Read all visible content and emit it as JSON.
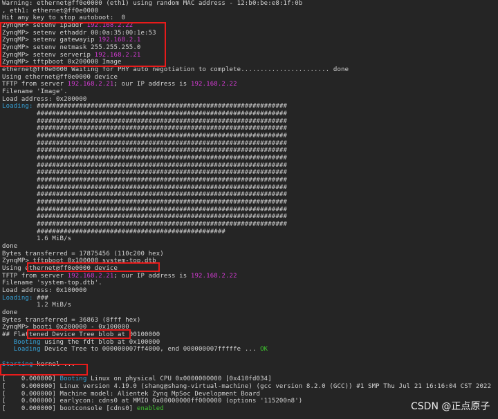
{
  "terminal": {
    "lines": [
      [
        {
          "t": "Warning: ethernet@ff0e0000 (eth1) using random MAC address - 12:b0:be:e8:1f:0b"
        }
      ],
      [
        {
          "t": ", eth1: ethernet@ff0e0000"
        }
      ],
      [
        {
          "t": "Hit any key to stop autoboot:  0"
        }
      ],
      [
        {
          "t": "ZynqMP> setenv ipaddr "
        },
        {
          "t": "192.168.2.22",
          "c": "pink"
        }
      ],
      [
        {
          "t": "ZynqMP> setenv ethaddr 00:0a:35:00:1e:53"
        }
      ],
      [
        {
          "t": "ZynqMP> setenv gatewayip "
        },
        {
          "t": "192.168.2.1",
          "c": "pink"
        }
      ],
      [
        {
          "t": "ZynqMP> setenv netmask 255.255.255.0"
        }
      ],
      [
        {
          "t": "ZynqMP> setenv serverip "
        },
        {
          "t": "192.168.2.21",
          "c": "pink"
        }
      ],
      [
        {
          "t": "ZynqMP> tftpboot 0x200000 Image"
        }
      ],
      [
        {
          "t": "ethernet@ff0e0000 Waiting for PHY auto negotiation to complete....................... done"
        }
      ],
      [
        {
          "t": "Using ethernet@ff0e0000 device"
        }
      ],
      [
        {
          "t": "TFTP from server "
        },
        {
          "t": "192.168.2.21",
          "c": "pink"
        },
        {
          "t": "; our IP address is "
        },
        {
          "t": "192.168.2.22",
          "c": "pink"
        }
      ],
      [
        {
          "t": "Filename 'Image'."
        }
      ],
      [
        {
          "t": "Load address: 0x200000"
        }
      ],
      [
        {
          "t": "Loading:",
          "c": "cyan"
        },
        {
          "t": " #################################################################"
        }
      ],
      [
        {
          "t": "         #################################################################"
        }
      ],
      [
        {
          "t": "         #################################################################"
        }
      ],
      [
        {
          "t": "         #################################################################"
        }
      ],
      [
        {
          "t": "         #################################################################"
        }
      ],
      [
        {
          "t": "         #################################################################"
        }
      ],
      [
        {
          "t": "         #################################################################"
        }
      ],
      [
        {
          "t": "         #################################################################"
        }
      ],
      [
        {
          "t": "         #################################################################"
        }
      ],
      [
        {
          "t": "         #################################################################"
        }
      ],
      [
        {
          "t": "         #################################################################"
        }
      ],
      [
        {
          "t": "         #################################################################"
        }
      ],
      [
        {
          "t": "         #################################################################"
        }
      ],
      [
        {
          "t": "         #################################################################"
        }
      ],
      [
        {
          "t": "         #################################################################"
        }
      ],
      [
        {
          "t": "         #################################################################"
        }
      ],
      [
        {
          "t": "         #################################################################"
        }
      ],
      [
        {
          "t": "         #################################################"
        }
      ],
      [
        {
          "t": "         1.6 MiB/s"
        }
      ],
      [
        {
          "t": "done"
        }
      ],
      [
        {
          "t": "Bytes transferred = 17875456 (110c200 hex)"
        }
      ],
      [
        {
          "t": "ZynqMP> tftpboot 0x100000 system-top.dtb"
        }
      ],
      [
        {
          "t": "Using ethernet@ff0e0000 device"
        }
      ],
      [
        {
          "t": "TFTP from server "
        },
        {
          "t": "192.168.2.21",
          "c": "pink"
        },
        {
          "t": "; our IP address is "
        },
        {
          "t": "192.168.2.22",
          "c": "pink"
        }
      ],
      [
        {
          "t": "Filename 'system-top.dtb'."
        }
      ],
      [
        {
          "t": "Load address: 0x100000"
        }
      ],
      [
        {
          "t": "Loading:",
          "c": "cyan"
        },
        {
          "t": " ###"
        }
      ],
      [
        {
          "t": "         1.2 MiB/s"
        }
      ],
      [
        {
          "t": "done"
        }
      ],
      [
        {
          "t": "Bytes transferred = 36863 (8fff hex)"
        }
      ],
      [
        {
          "t": "ZynqMP> booti 0x200000 - 0x100000"
        }
      ],
      [
        {
          "t": "## Flattened Device Tree blob at 00100000"
        }
      ],
      [
        {
          "t": "   Booting",
          "c": "cyan"
        },
        {
          "t": " using the fdt blob at 0x100000"
        }
      ],
      [
        {
          "t": "   Loading",
          "c": "cyan"
        },
        {
          "t": " Device Tree to 000000007ff4000, end 000000007fffffe ... "
        },
        {
          "t": "OK",
          "c": "green"
        }
      ],
      [
        {
          "t": ""
        }
      ],
      [
        {
          "t": "Starting",
          "c": "cyan"
        },
        {
          "t": " kernel ..."
        }
      ],
      [
        {
          "t": ""
        }
      ],
      [
        {
          "t": "[    0.000000] "
        },
        {
          "t": "Booting",
          "c": "cyan"
        },
        {
          "t": " Linux on physical CPU 0x0000000000 [0x410fd034]"
        }
      ],
      [
        {
          "t": "[    0.000000] Linux version 4.19.0 (shang@shang-virtual-machine) (gcc version 8.2.0 (GCC)) #1 SMP Thu Jul 21 16:16:04 CST 2022"
        }
      ],
      [
        {
          "t": "[    0.000000] Machine model: Alientek Zynq MpSoc Development Board"
        }
      ],
      [
        {
          "t": "[    0.000000] earlycon: cdns0 at MMIO 0x00000000ff000000 (options '115200n8')"
        }
      ],
      [
        {
          "t": "[    0.000000] bootconsole [cdns0] "
        },
        {
          "t": "enabled",
          "c": "green"
        }
      ]
    ]
  },
  "watermark": "CSDN @正点原子"
}
